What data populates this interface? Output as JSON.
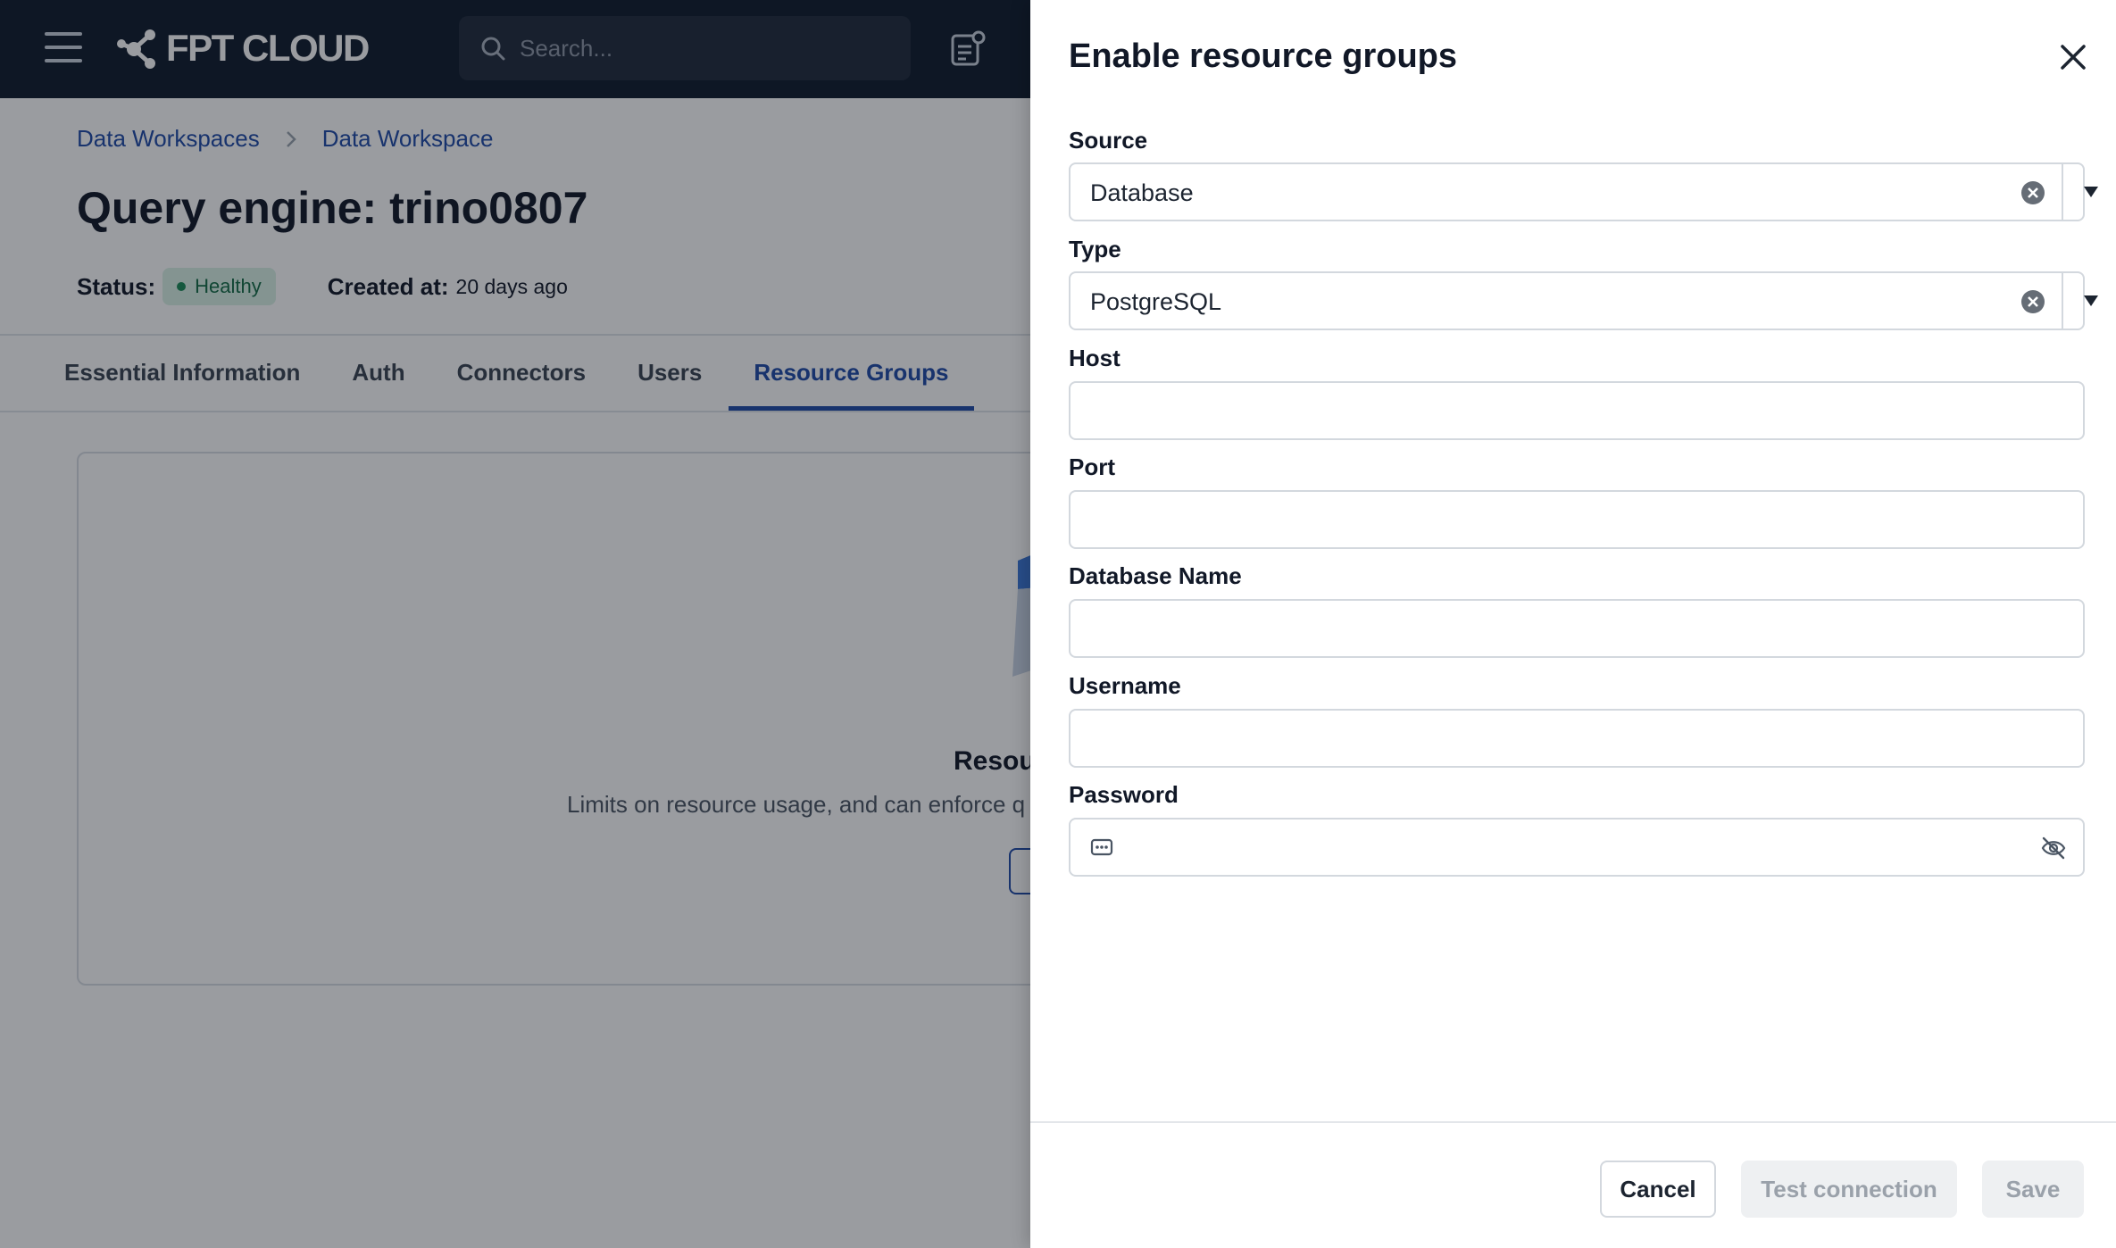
{
  "header": {
    "logo_text": "FPT CLOUD",
    "search_placeholder": "Search..."
  },
  "breadcrumb": {
    "items": [
      "Data Workspaces",
      "Data Workspace"
    ]
  },
  "page": {
    "title": "Query engine: trino0807",
    "status_label": "Status:",
    "status_value": "Healthy",
    "created_label": "Created at:",
    "created_value": "20 days ago"
  },
  "tabs": [
    {
      "label": "Essential Information",
      "active": false
    },
    {
      "label": "Auth",
      "active": false
    },
    {
      "label": "Connectors",
      "active": false
    },
    {
      "label": "Users",
      "active": false
    },
    {
      "label": "Resource Groups",
      "active": true
    }
  ],
  "empty_state": {
    "title": "Resou",
    "description": "Limits on resource usage, and can enforce q"
  },
  "drawer": {
    "title": "Enable resource groups",
    "fields": {
      "source": {
        "label": "Source",
        "value": "Database"
      },
      "type": {
        "label": "Type",
        "value": "PostgreSQL"
      },
      "host": {
        "label": "Host",
        "value": ""
      },
      "port": {
        "label": "Port",
        "value": ""
      },
      "database_name": {
        "label": "Database Name",
        "value": ""
      },
      "username": {
        "label": "Username",
        "value": ""
      },
      "password": {
        "label": "Password",
        "value": ""
      }
    },
    "buttons": {
      "cancel": "Cancel",
      "test_connection": "Test connection",
      "save": "Save"
    }
  },
  "colors": {
    "header_bg": "#0f1a2b",
    "accent": "#1f4aa8",
    "status_badge_bg": "#d9f2e6",
    "status_badge_text": "#136c45"
  }
}
